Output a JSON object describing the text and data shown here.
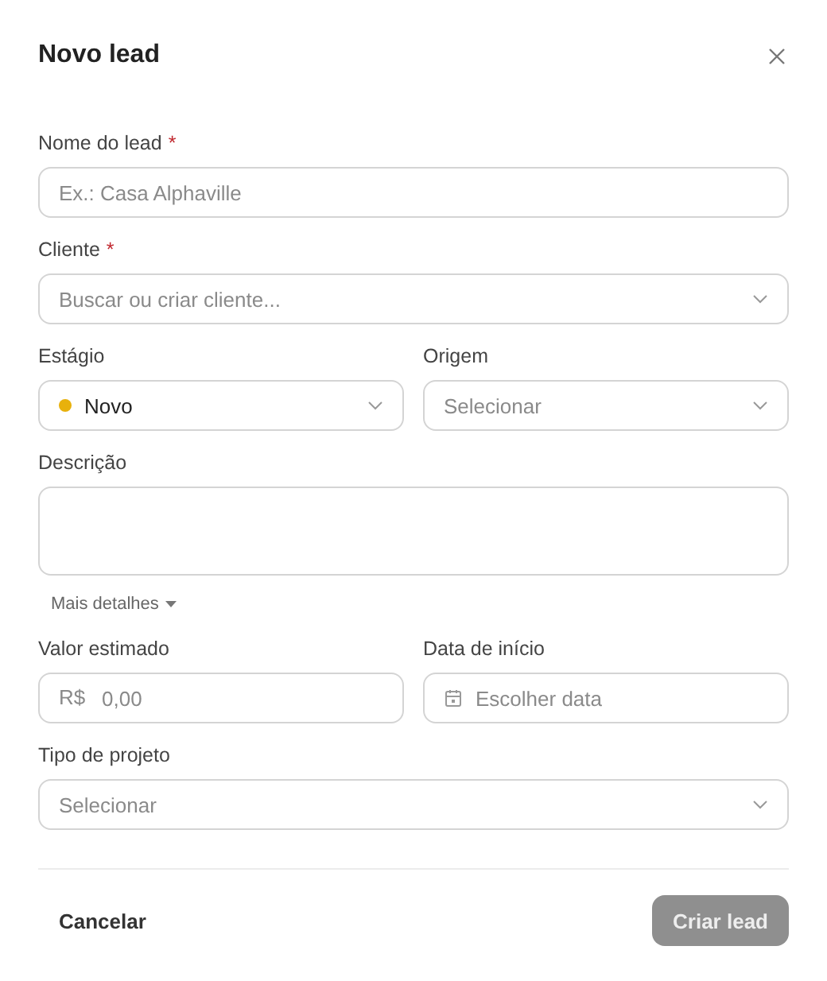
{
  "dialog": {
    "title": "Novo lead"
  },
  "rows": [
    {
      "fields": [
        {
          "kind": "text",
          "label": "Nome do lead",
          "required_mark": "*",
          "placeholder": "Ex.: Casa Alphaville"
        }
      ]
    },
    {
      "fields": [
        {
          "kind": "select",
          "label": "Cliente",
          "required_mark": "*",
          "placeholder": "Buscar ou criar cliente..."
        }
      ]
    },
    {
      "fields": [
        {
          "kind": "select",
          "label": "Estágio",
          "value": "Novo",
          "color": "#e8b10c"
        },
        {
          "kind": "select",
          "label": "Origem",
          "placeholder": "Selecionar"
        }
      ]
    },
    {
      "fields": [
        {
          "kind": "textarea",
          "label": "Descrição"
        }
      ]
    }
  ],
  "more_details": {
    "label": "Mais detalhes"
  },
  "more_rows": [
    {
      "fields": [
        {
          "kind": "money",
          "label": "Valor estimado",
          "prefix": "R$",
          "placeholder": "0,00"
        },
        {
          "kind": "date",
          "label": "Data de início",
          "placeholder": "Escolher data"
        }
      ]
    },
    {
      "fields": [
        {
          "kind": "select",
          "label": "Tipo de projeto",
          "placeholder": "Selecionar"
        }
      ]
    }
  ],
  "footer": {
    "cancel": "Cancelar",
    "submit": {
      "label": "Criar lead",
      "disabled": true
    }
  }
}
